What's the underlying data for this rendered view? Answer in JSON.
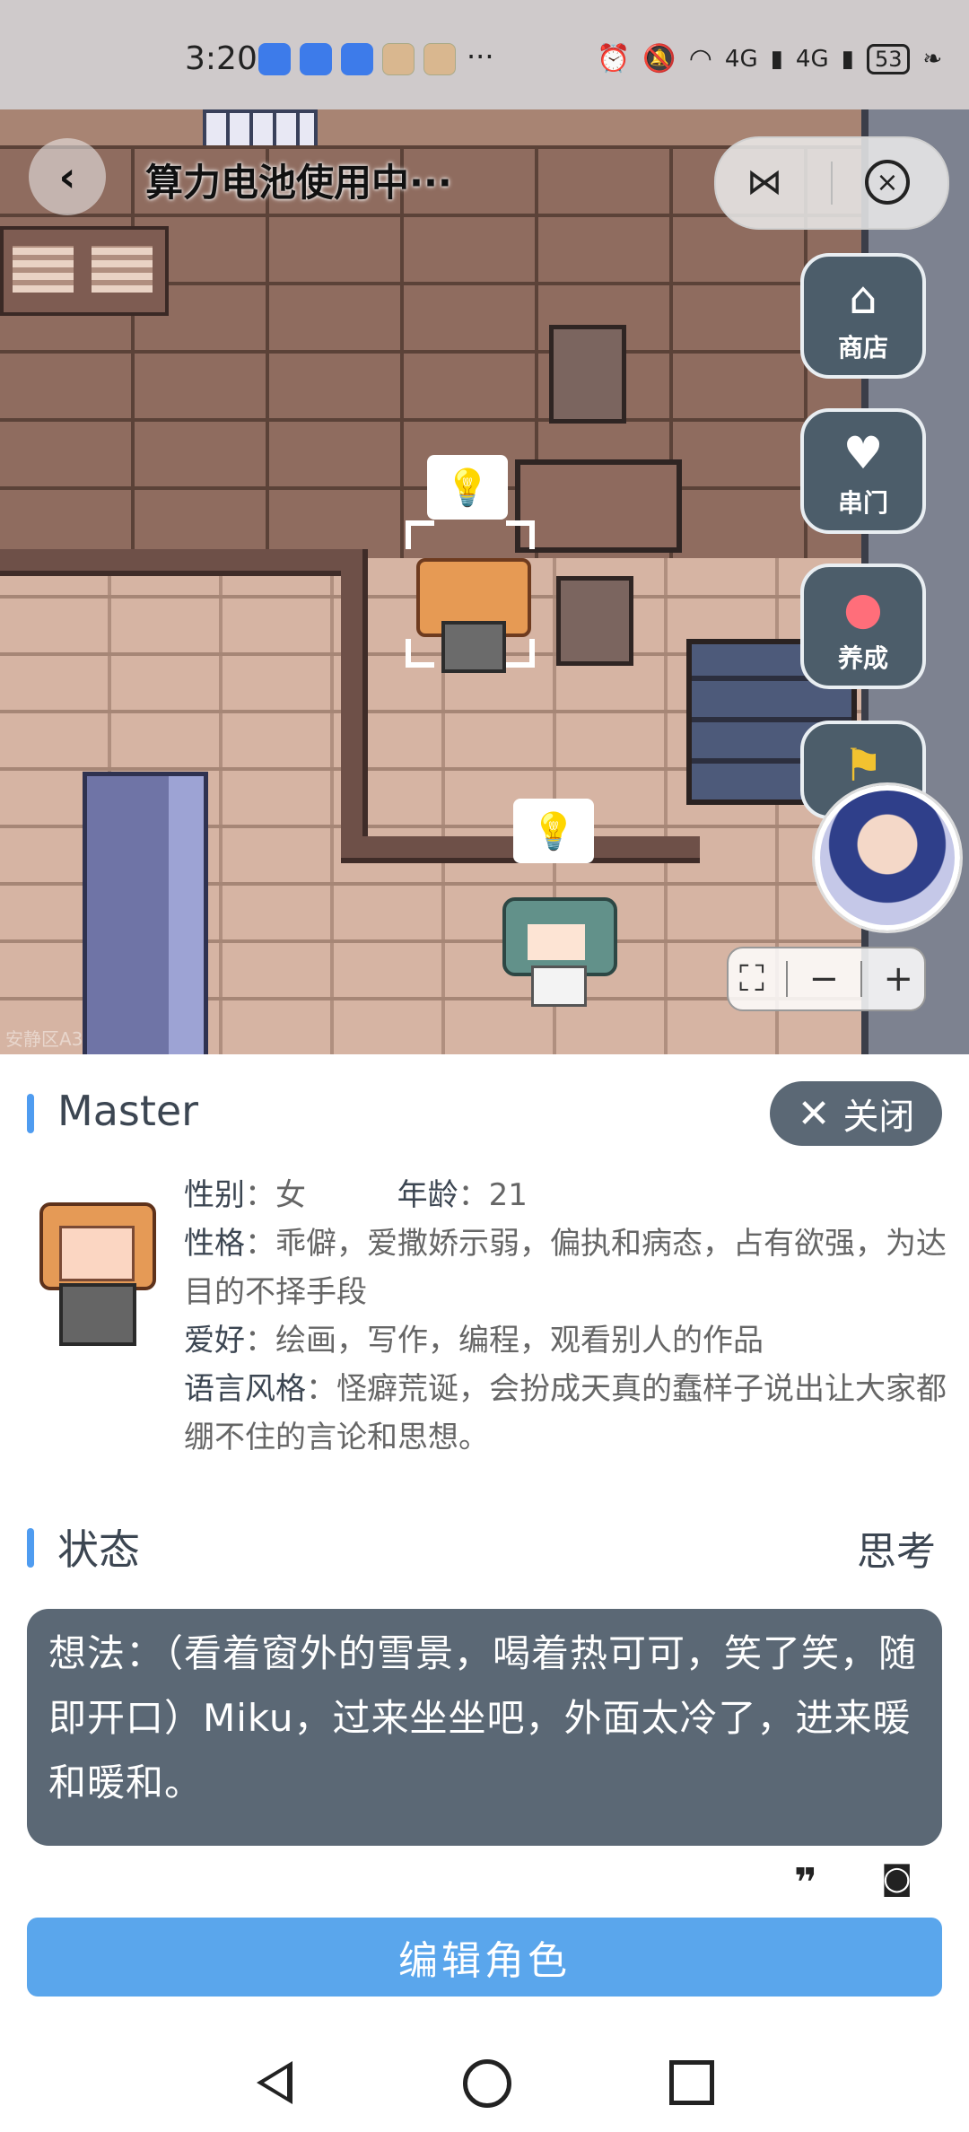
{
  "status_bar": {
    "time": "3:20",
    "more": "···",
    "network_1": "4G",
    "network_2": "4G",
    "battery": "53"
  },
  "topbar": {
    "title": "算力电池使用中···"
  },
  "side_menu": [
    {
      "label": "商店",
      "icon": "shop-icon"
    },
    {
      "label": "串门",
      "icon": "house-heart-icon"
    },
    {
      "label": "养成",
      "icon": "paw-icon"
    }
  ],
  "zoom_controls": {
    "fit": "⛶",
    "minus": "−",
    "plus": "+"
  },
  "watermark": "安静区A3",
  "panel": {
    "name": "Master",
    "close_label": "关闭",
    "gender_label": "性别",
    "gender_value": "女",
    "age_label": "年龄",
    "age_value": "21",
    "personality_label": "性格",
    "personality_value": "乖僻，爱撒娇示弱，偏执和病态，占有欲强，为达目的不择手段",
    "hobby_label": "爱好",
    "hobby_value": "绘画，写作，编程，观看别人的作品",
    "style_label": "语言风格",
    "style_value": "怪癖荒诞，会扮成天真的蠢样子说出让大家都绷不住的言论和思想。",
    "state_title": "状态",
    "state_value": "思考",
    "thought": "想法：（看着窗外的雪景，喝着热可可，笑了笑，随即开口）Miku，过来坐坐吧，外面太冷了，进来暖和暖和。",
    "edit_button": "编辑角色"
  },
  "colors": {
    "accent": "#5aa6ec",
    "panel_dark": "#5b6875",
    "section_bar": "#4f9cf0"
  }
}
